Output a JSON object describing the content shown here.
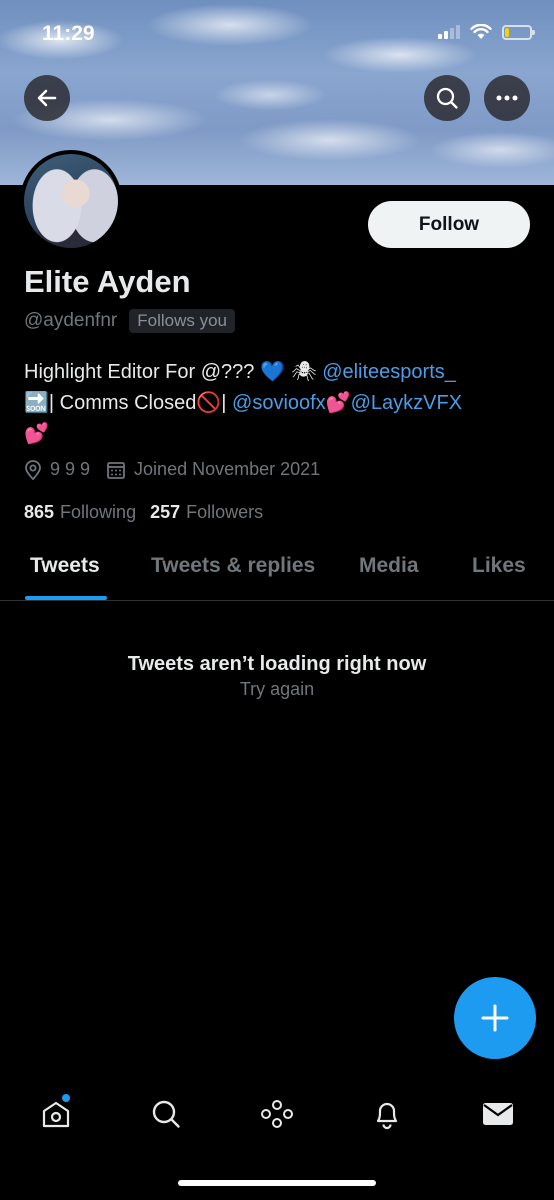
{
  "status_bar": {
    "time": "11:29",
    "signal_icon": "cellular-signal-icon",
    "wifi_icon": "wifi-icon",
    "battery_icon": "battery-low-icon",
    "battery_level": 0.15
  },
  "header": {
    "back_icon": "back-arrow-icon",
    "search_icon": "search-icon",
    "more_icon": "more-icon"
  },
  "profile": {
    "follow_label": "Follow",
    "display_name": "Elite Ayden",
    "handle": "@aydenfnr",
    "follows_you": "Follows you",
    "bio": {
      "line1_text": "Highlight Editor For @??? ",
      "line1_emoji": "💙 🕷",
      "line1_mention": "@eliteesports_",
      "line2_prefix_emoji": "🔜",
      "line2_text": "| Comms Closed",
      "line2_emoji_no": "🚫",
      "line2_sep": "| ",
      "line2_mention1": "@sovioofx",
      "line2_emoji_hearts": "💕",
      "line2_mention2": "@LaykzVFX",
      "line3_emoji": "💕"
    },
    "location": "9 9 9",
    "joined": "Joined November 2021",
    "following_count": "865",
    "following_label": "Following",
    "followers_count": "257",
    "followers_label": "Followers"
  },
  "tabs": [
    {
      "label": "Tweets",
      "active": true
    },
    {
      "label": "Tweets & replies",
      "active": false
    },
    {
      "label": "Media",
      "active": false
    },
    {
      "label": "Likes",
      "active": false
    }
  ],
  "empty_state": {
    "title": "Tweets aren’t loading right now",
    "action": "Try again"
  },
  "bottom_nav": [
    {
      "icon": "home-icon",
      "has_dot": true
    },
    {
      "icon": "search-icon",
      "has_dot": false
    },
    {
      "icon": "spaces-icon",
      "has_dot": false
    },
    {
      "icon": "notifications-bell-icon",
      "has_dot": false
    },
    {
      "icon": "messages-envelope-icon",
      "has_dot": false
    }
  ],
  "colors": {
    "accent": "#1d9bf0",
    "mention": "#4b9de6",
    "background": "#000000"
  }
}
